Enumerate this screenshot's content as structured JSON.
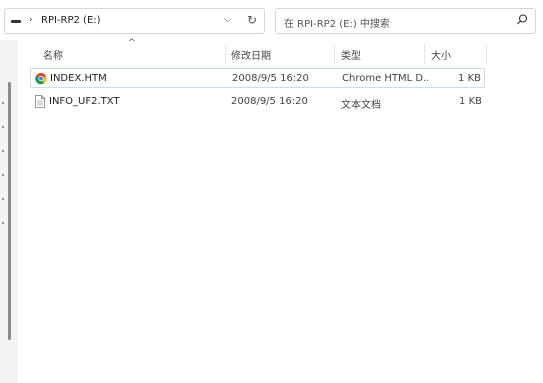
{
  "address": {
    "path": "RPI-RP2 (E:)",
    "drive_icon": "drive-icon",
    "chevron": "›"
  },
  "search": {
    "placeholder": "在 RPI-RP2 (E:) 中搜索"
  },
  "columns": {
    "name": "名称",
    "date": "修改日期",
    "type": "类型",
    "size": "大小"
  },
  "files": [
    {
      "name": "INDEX.HTM",
      "date": "2008/9/5 16:20",
      "type": "Chrome HTML D...",
      "size": "1 KB",
      "icon": "chrome-icon",
      "selected": true
    },
    {
      "name": "INFO_UF2.TXT",
      "date": "2008/9/5 16:20",
      "type": "文本文档",
      "size": "1 KB",
      "icon": "text-file-icon",
      "selected": false
    }
  ]
}
